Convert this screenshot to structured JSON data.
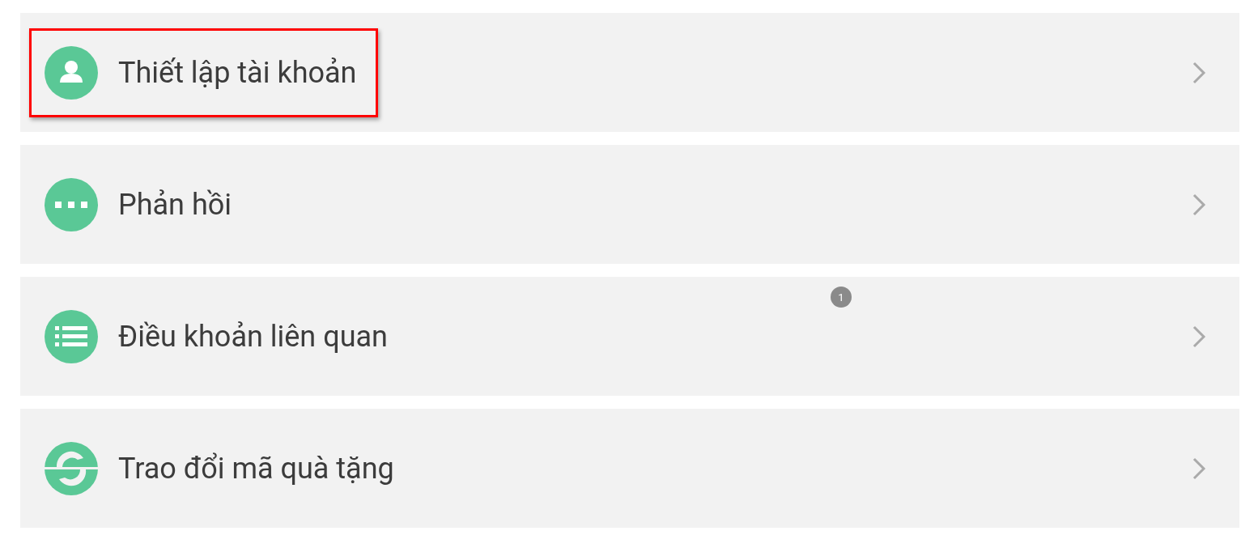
{
  "menu_items": [
    {
      "label": "Thiết lập tài khoản",
      "kind": "account",
      "highlighted": true
    },
    {
      "label": "Phản hồi",
      "kind": "feedback",
      "highlighted": false
    },
    {
      "label": "Điều khoản liên quan",
      "kind": "terms",
      "highlighted": false,
      "badge": "1"
    },
    {
      "label": "Trao đổi mã quà tặng",
      "kind": "exchange",
      "highlighted": false
    }
  ]
}
